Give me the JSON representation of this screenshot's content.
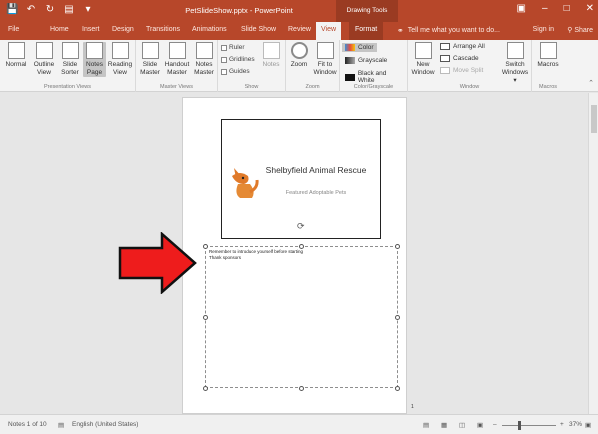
{
  "window": {
    "title": "PetSlideShow.pptx - PowerPoint",
    "contextual_tab_group": "Drawing Tools",
    "accent": "#b7472a"
  },
  "tabs": [
    "File",
    "Home",
    "Insert",
    "Design",
    "Transitions",
    "Animations",
    "Slide Show",
    "Review",
    "View",
    "Format"
  ],
  "active_tab": "View",
  "tell_me": "Tell me what you want to do...",
  "sign_in": "Sign in",
  "share": "Share",
  "ribbon": {
    "presentation_views": {
      "label": "Presentation Views",
      "buttons": [
        {
          "l1": "Normal",
          "l2": ""
        },
        {
          "l1": "Outline",
          "l2": "View"
        },
        {
          "l1": "Slide",
          "l2": "Sorter"
        },
        {
          "l1": "Notes",
          "l2": "Page"
        },
        {
          "l1": "Reading",
          "l2": "View"
        }
      ]
    },
    "master_views": {
      "label": "Master Views",
      "buttons": [
        {
          "l1": "Slide",
          "l2": "Master"
        },
        {
          "l1": "Handout",
          "l2": "Master"
        },
        {
          "l1": "Notes",
          "l2": "Master"
        }
      ]
    },
    "show": {
      "label": "Show",
      "ruler": "Ruler",
      "gridlines": "Gridlines",
      "guides": "Guides",
      "notes": "Notes"
    },
    "zoom": {
      "label": "Zoom",
      "zoom": "Zoom",
      "fit_l1": "Fit to",
      "fit_l2": "Window"
    },
    "color": {
      "label": "Color/Grayscale",
      "color": "Color",
      "grayscale": "Grayscale",
      "bw": "Black and White"
    },
    "window": {
      "label": "Window",
      "new_l1": "New",
      "new_l2": "Window",
      "arrange_all": "Arrange All",
      "cascade": "Cascade",
      "move_split": "Move Split",
      "switch_l1": "Switch",
      "switch_l2": "Windows"
    },
    "macros": {
      "label": "Macros",
      "button": "Macros"
    }
  },
  "slide": {
    "title": "Shelbyfield Animal Rescue",
    "subtitle": "Featured Adoptable Pets"
  },
  "notes": {
    "line1": "Remember to introduce yourself before starting",
    "line2": "Thank sponsors"
  },
  "page_number": "1",
  "status": {
    "slide_info": "Notes 1 of 10",
    "language": "English (United States)",
    "zoom": "37%"
  }
}
